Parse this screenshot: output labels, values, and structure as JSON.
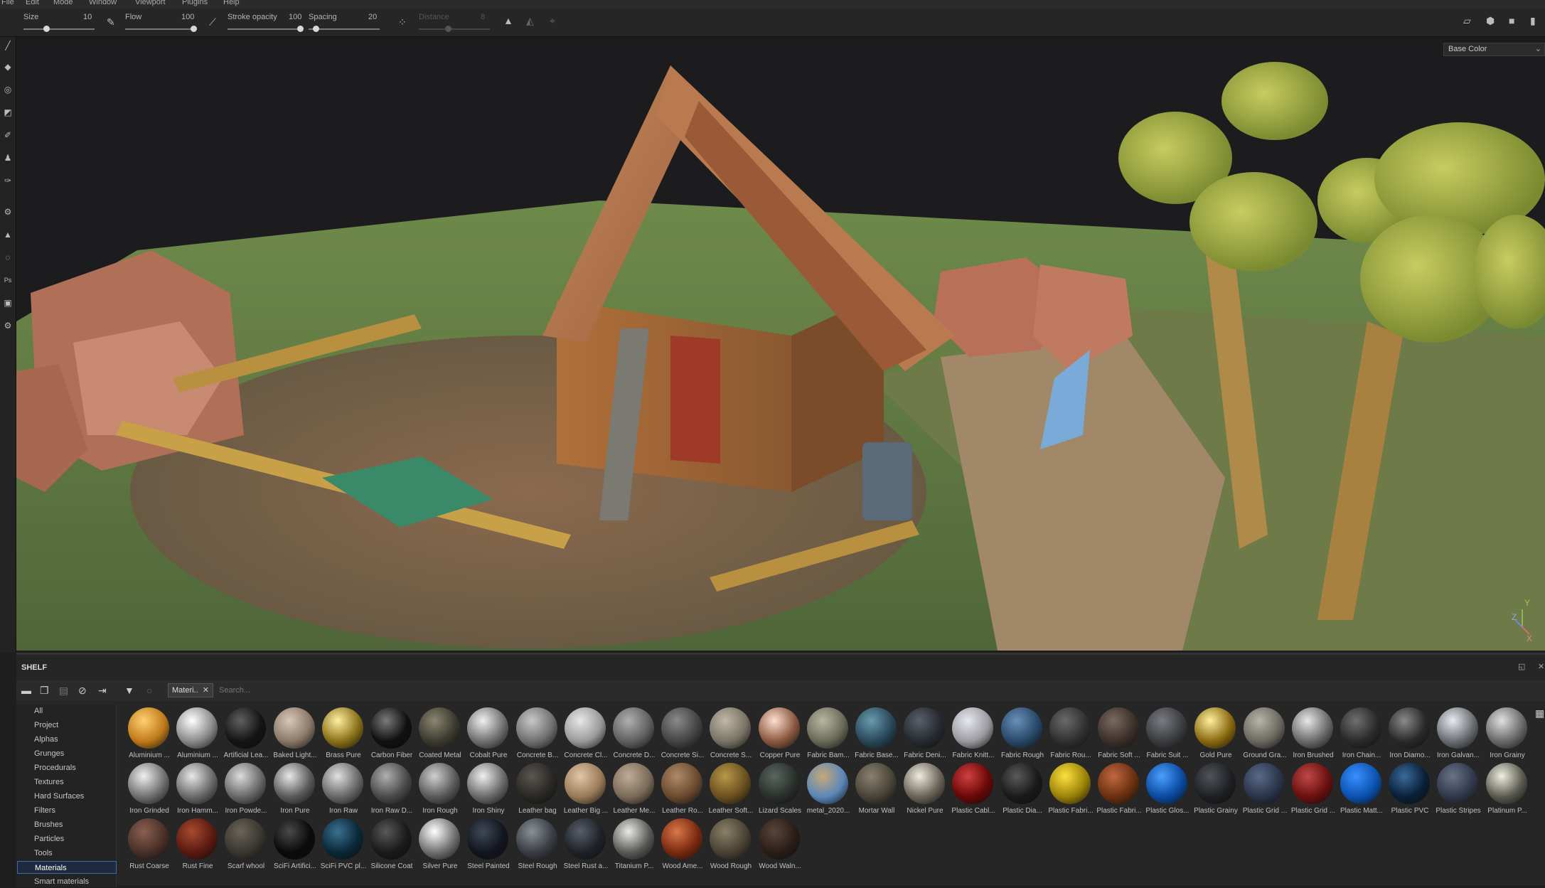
{
  "menu": [
    "File",
    "Edit",
    "Mode",
    "Window",
    "Viewport",
    "Plugins",
    "Help"
  ],
  "toolbar": {
    "size_label": "Size",
    "size_value": "10",
    "flow_label": "Flow",
    "flow_value": "100",
    "stroke_label": "Stroke opacity",
    "stroke_value": "100",
    "spacing_label": "Spacing",
    "spacing_value": "20",
    "distance_label": "Distance",
    "distance_value": "8"
  },
  "viewport": {
    "channel_select": "Base Color",
    "axis_labels": [
      "Y",
      "Z",
      "X"
    ]
  },
  "shelf": {
    "title": "SHELF",
    "filter_chip": "Materi..",
    "search_placeholder": "Search...",
    "categories": [
      "All",
      "Project",
      "Alphas",
      "Grunges",
      "Procedurals",
      "Textures",
      "Hard Surfaces",
      "Filters",
      "Brushes",
      "Particles",
      "Tools",
      "Materials",
      "Smart materials"
    ],
    "selected_category": "Materials",
    "materials": [
      {
        "name": "Aluminium ...",
        "color": "#c07a1a",
        "color2": "#ffd070"
      },
      {
        "name": "Aluminium ...",
        "color": "#8a8a8a",
        "color2": "#ffffff"
      },
      {
        "name": "Artificial Lea...",
        "color": "#141414",
        "color2": "#606060"
      },
      {
        "name": "Baked Light...",
        "color": "#8a7868",
        "color2": "#d9c8b8"
      },
      {
        "name": "Brass Pure",
        "color": "#8a7018",
        "color2": "#fff0a0"
      },
      {
        "name": "Carbon Fiber",
        "color": "#101010",
        "color2": "#7a7a7a"
      },
      {
        "name": "Coated Metal",
        "color": "#3c3a30",
        "color2": "#8a8670"
      },
      {
        "name": "Cobalt Pure",
        "color": "#707070",
        "color2": "#f0f0f0"
      },
      {
        "name": "Concrete B...",
        "color": "#707070",
        "color2": "#c8c8c8"
      },
      {
        "name": "Concrete Cl...",
        "color": "#9a9a9a",
        "color2": "#e8e8e8"
      },
      {
        "name": "Concrete D...",
        "color": "#606060",
        "color2": "#b0b0b0"
      },
      {
        "name": "Concrete Si...",
        "color": "#444444",
        "color2": "#8a8a8a"
      },
      {
        "name": "Concrete S...",
        "color": "#7a7466",
        "color2": "#c0b8a8"
      },
      {
        "name": "Copper Pure",
        "color": "#8a5840",
        "color2": "#ffe0d0"
      },
      {
        "name": "Fabric Bam...",
        "color": "#6a6a58",
        "color2": "#b8b8a0"
      },
      {
        "name": "Fabric Base...",
        "color": "#284858",
        "color2": "#6a9ab0"
      },
      {
        "name": "Fabric Deni...",
        "color": "#262a30",
        "color2": "#5a606a"
      },
      {
        "name": "Fabric Knitt...",
        "color": "#9a9aa0",
        "color2": "#e8e8f0"
      },
      {
        "name": "Fabric Rough",
        "color": "#284868",
        "color2": "#6a90b8"
      },
      {
        "name": "Fabric Rou...",
        "color": "#303030",
        "color2": "#6a6a6a"
      },
      {
        "name": "Fabric Soft ...",
        "color": "#3c302a",
        "color2": "#7a6a60"
      },
      {
        "name": "Fabric Suit ...",
        "color": "#3a3c40",
        "color2": "#7a7c82"
      },
      {
        "name": "Gold Pure",
        "color": "#8a6a10",
        "color2": "#fff0a0"
      },
      {
        "name": "Ground Gra...",
        "color": "#6a6860",
        "color2": "#b8b4a8"
      },
      {
        "name": "Iron Brushed",
        "color": "#6a6a6a",
        "color2": "#e8e8e8"
      },
      {
        "name": "Iron Chain...",
        "color": "#2a2a2a",
        "color2": "#707070"
      },
      {
        "name": "Iron Diamo...",
        "color": "#2a2a2a",
        "color2": "#8a8a8a"
      },
      {
        "name": "Iron Galvan...",
        "color": "#6a6e72",
        "color2": "#e8ecf0"
      },
      {
        "name": "Iron Grainy",
        "color": "#6a6a6a",
        "color2": "#e0e0e0"
      },
      {
        "name": "Iron Grinded",
        "color": "#707070",
        "color2": "#f0f0f0"
      },
      {
        "name": "Iron Hamm...",
        "color": "#6a6a6a",
        "color2": "#e8e8e8"
      },
      {
        "name": "Iron Powde...",
        "color": "#686868",
        "color2": "#dcdcdc"
      },
      {
        "name": "Iron Pure",
        "color": "#5a5a5a",
        "color2": "#e8e8e8"
      },
      {
        "name": "Iron Raw",
        "color": "#686868",
        "color2": "#e0e0e0"
      },
      {
        "name": "Iron Raw D...",
        "color": "#4a4a4a",
        "color2": "#b0b0b0"
      },
      {
        "name": "Iron Rough",
        "color": "#5a5a5a",
        "color2": "#d0d0d0"
      },
      {
        "name": "Iron Shiny",
        "color": "#6a6a6a",
        "color2": "#f0f0f0"
      },
      {
        "name": "Leather bag",
        "color": "#2a2824",
        "color2": "#5a5650"
      },
      {
        "name": "Leather Big ...",
        "color": "#9a7a58",
        "color2": "#e0c8a8"
      },
      {
        "name": "Leather Me...",
        "color": "#7a6a58",
        "color2": "#c0ac98"
      },
      {
        "name": "Leather Ro...",
        "color": "#6a4a30",
        "color2": "#b08a68"
      },
      {
        "name": "Leather Soft...",
        "color": "#6a5020",
        "color2": "#b89848"
      },
      {
        "name": "Lizard Scales",
        "color": "#2a302c",
        "color2": "#5a6660"
      },
      {
        "name": "metal_2020...",
        "color": "#5a88b8",
        "color2": "#c8a878"
      },
      {
        "name": "Mortar Wall",
        "color": "#4a4438",
        "color2": "#8a8270"
      },
      {
        "name": "Nickel Pure",
        "color": "#6a6458",
        "color2": "#f0ece0"
      },
      {
        "name": "Plastic Cabl...",
        "color": "#6a0808",
        "color2": "#d04040"
      },
      {
        "name": "Plastic Dia...",
        "color": "#1a1a1a",
        "color2": "#5a5a5a"
      },
      {
        "name": "Plastic Fabri...",
        "color": "#9a8208",
        "color2": "#ffe040"
      },
      {
        "name": "Plastic Fabri...",
        "color": "#6a3010",
        "color2": "#c06840"
      },
      {
        "name": "Plastic Glos...",
        "color": "#0a4aa0",
        "color2": "#4aa0ff"
      },
      {
        "name": "Plastic Grainy",
        "color": "#1e2024",
        "color2": "#50545a"
      },
      {
        "name": "Plastic Grid ...",
        "color": "#2a3448",
        "color2": "#5a6a88"
      },
      {
        "name": "Plastic Grid ...",
        "color": "#6a1010",
        "color2": "#c04848"
      },
      {
        "name": "Plastic Matt...",
        "color": "#0a52b0",
        "color2": "#3a90ff"
      },
      {
        "name": "Plastic PVC",
        "color": "#0a2038",
        "color2": "#3a6a98"
      },
      {
        "name": "Plastic Stripes",
        "color": "#30384a",
        "color2": "#6a7488"
      },
      {
        "name": "Platinum P...",
        "color": "#5a5a50",
        "color2": "#f0f0e0"
      },
      {
        "name": "Rust Coarse",
        "color": "#4a3028",
        "color2": "#8a6050"
      },
      {
        "name": "Rust Fine",
        "color": "#5a1a10",
        "color2": "#a84a30"
      },
      {
        "name": "Scarf whool",
        "color": "#3a3630",
        "color2": "#6a6458"
      },
      {
        "name": "SciFi Artifici...",
        "color": "#0a0a0a",
        "color2": "#4a4a4a"
      },
      {
        "name": "SciFi PVC pl...",
        "color": "#0a2838",
        "color2": "#3a7090"
      },
      {
        "name": "Silicone Coat",
        "color": "#1a1a1a",
        "color2": "#585858"
      },
      {
        "name": "Silver Pure",
        "color": "#707070",
        "color2": "#ffffff"
      },
      {
        "name": "Steel Painted",
        "color": "#12161e",
        "color2": "#404858"
      },
      {
        "name": "Steel Rough",
        "color": "#3a3e44",
        "color2": "#8a9098"
      },
      {
        "name": "Steel Rust a...",
        "color": "#1e2228",
        "color2": "#585e68"
      },
      {
        "name": "Titanium P...",
        "color": "#5a5a58",
        "color2": "#eaeae6"
      },
      {
        "name": "Wood Ame...",
        "color": "#7a2a10",
        "color2": "#d87848"
      },
      {
        "name": "Wood Rough",
        "color": "#4a4234",
        "color2": "#8a8068"
      },
      {
        "name": "Wood Waln...",
        "color": "#2a1e18",
        "color2": "#5a4438"
      }
    ]
  }
}
